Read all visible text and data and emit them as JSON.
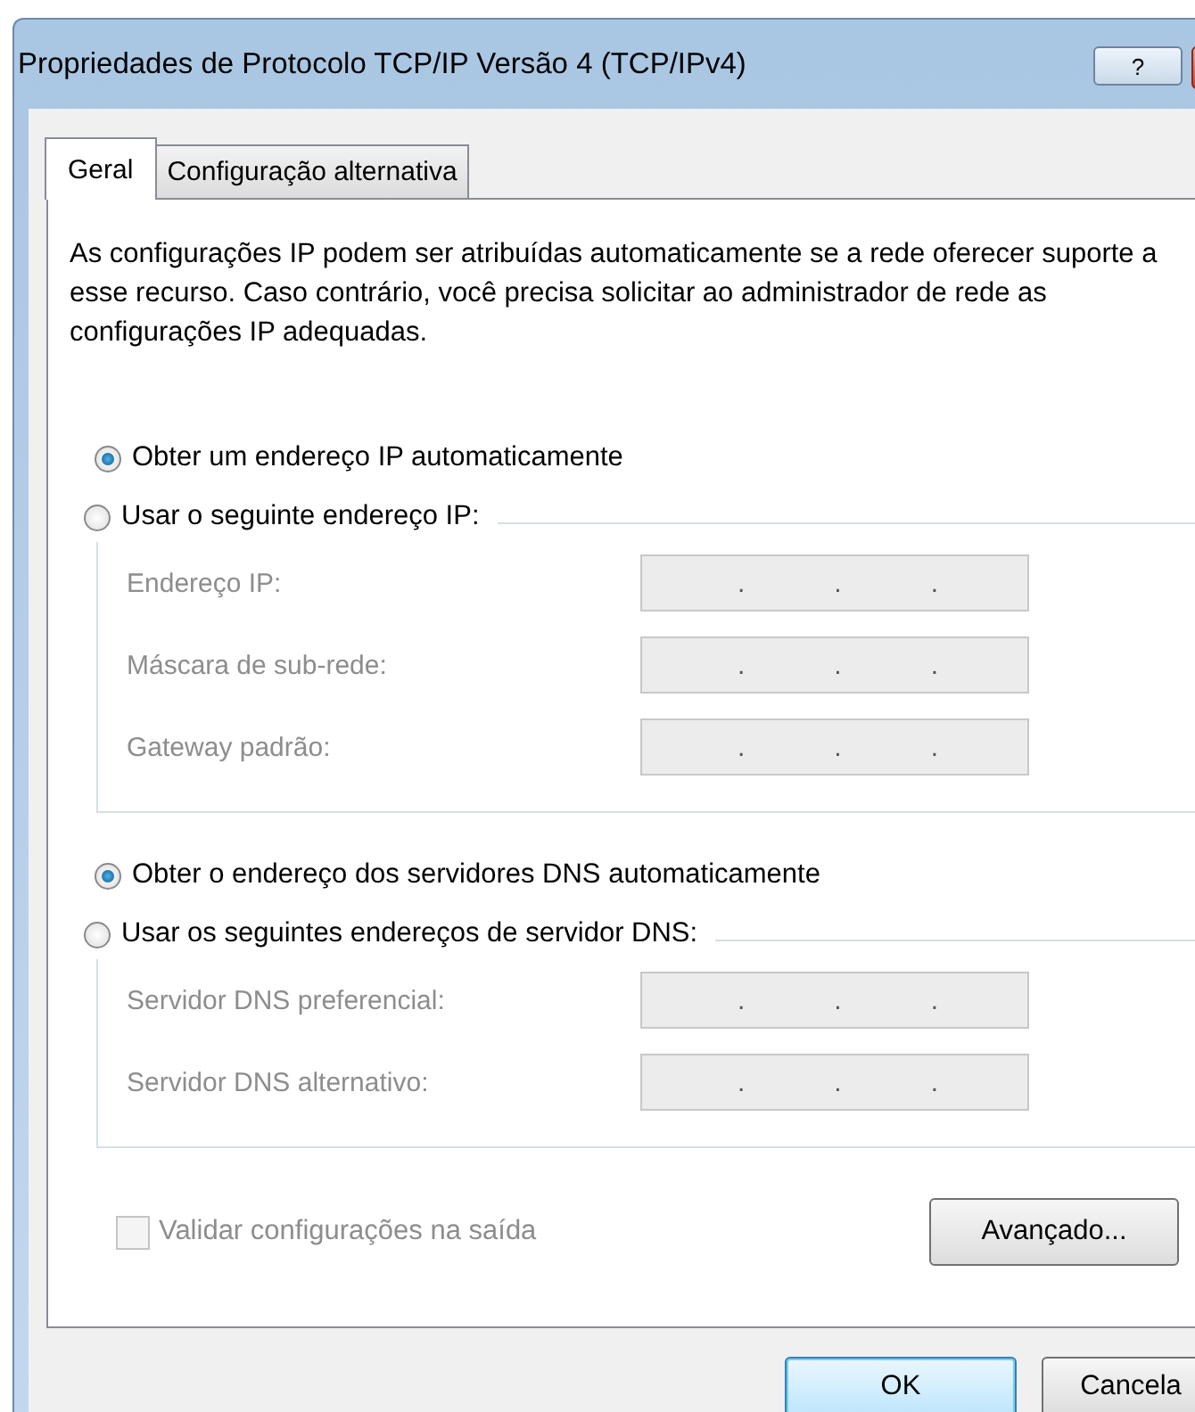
{
  "window": {
    "title": "Propriedades de Protocolo TCP/IP Versão 4 (TCP/IPv4)",
    "help_button": "?"
  },
  "tabs": [
    {
      "label": "Geral",
      "selected": true
    },
    {
      "label": "Configuração alternativa",
      "selected": false
    }
  ],
  "description": "As configurações IP podem ser atribuídas automaticamente se a rede oferecer suporte a esse recurso. Caso contrário, você precisa solicitar ao administrador de rede as configurações IP adequadas.",
  "groups": [
    {
      "auto_option": {
        "label": "Obter um endereço IP automaticamente",
        "selected": true
      },
      "manual_option": {
        "label": "Usar o seguinte endereço IP:",
        "selected": false
      },
      "fields": [
        {
          "label": "Endereço IP:",
          "disabled": true
        },
        {
          "label": "Máscara de sub-rede:",
          "disabled": true
        },
        {
          "label": "Gateway padrão:",
          "disabled": true
        }
      ]
    },
    {
      "auto_option": {
        "label": "Obter o endereço dos servidores DNS automaticamente",
        "selected": true
      },
      "manual_option": {
        "label": "Usar os seguintes endereços de servidor DNS:",
        "selected": false
      },
      "fields": [
        {
          "label": "Servidor DNS preferencial:",
          "disabled": true
        },
        {
          "label": "Servidor DNS alternativo:",
          "disabled": true
        }
      ]
    }
  ],
  "ip_separator": ".",
  "validate": {
    "label": "Validar configurações na saída",
    "checked": false,
    "disabled": true
  },
  "advanced_button": "Avançado...",
  "buttons": [
    {
      "label": "OK",
      "kind": "default"
    },
    {
      "label": "Cancela",
      "kind": "normal"
    }
  ]
}
